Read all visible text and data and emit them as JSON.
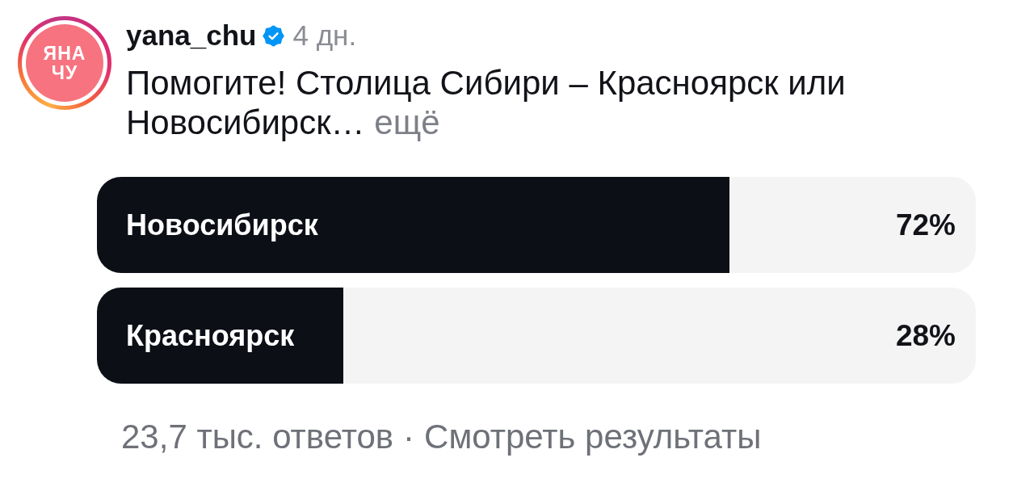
{
  "post": {
    "avatar": {
      "lines": [
        "ЯНА",
        "ЧУ"
      ]
    },
    "username": "yana_chu",
    "verified": true,
    "time": "4 дн.",
    "caption": "Помогите! Столица Сибири – Красноярск или Новосибирск…",
    "more": "ещё"
  },
  "poll": {
    "options": [
      {
        "label": "Новосибирск",
        "percent": "72%",
        "level": 0.72
      },
      {
        "label": "Красноярск",
        "percent": "28%",
        "level": 0.28
      }
    ]
  },
  "footer": {
    "responses": "23,7 тыс. ответов",
    "separator": "·",
    "link": "Смотреть результаты"
  }
}
